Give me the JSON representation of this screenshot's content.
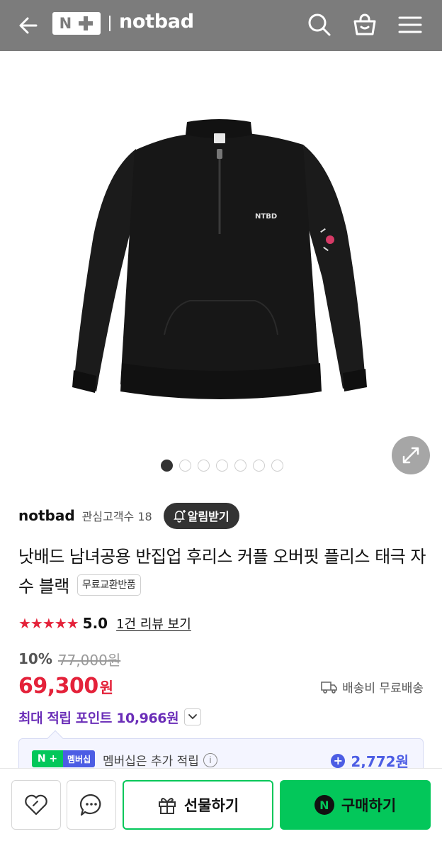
{
  "header": {
    "logo_letter": "N",
    "brand": "notbad",
    "bg_color": "#7c7c7c",
    "icons": [
      "back-arrow-icon",
      "search-icon",
      "shopping-basket-icon",
      "hamburger-menu-icon"
    ]
  },
  "product_image": {
    "logo_text": "NTBD",
    "slide_count": 7,
    "active_slide": 1
  },
  "store": {
    "name": "notbad",
    "followers_label": "관심고객수 18",
    "notify_label": "알림받기"
  },
  "product": {
    "title": "낫배드 남녀공용 반집업 후리스 커플 오버핏 플리스 태극 자수 블랙",
    "badge": "무료교환반품"
  },
  "rating": {
    "stars": "★★★★★",
    "score": "5.0",
    "review_link": "1건 리뷰 보기"
  },
  "price": {
    "discount": "10%",
    "original": "77,000원",
    "current": "69,300",
    "unit": "원",
    "shipping": "배송비 무료배송",
    "accent_color": "#e4223a"
  },
  "points": {
    "max_label": "최대 적립 포인트 10,966원"
  },
  "membership": {
    "badge_left": "N +",
    "badge_right": "멤버십",
    "text": "멤버십은 추가 적립",
    "info_glyph": "i",
    "amount": "2,772원",
    "accent_color": "#4c5de4"
  },
  "bottom_bar": {
    "gift_label": "선물하기",
    "buy_label": "구매하기",
    "buy_icon_letter": "N",
    "brand_color": "#03c75a"
  }
}
